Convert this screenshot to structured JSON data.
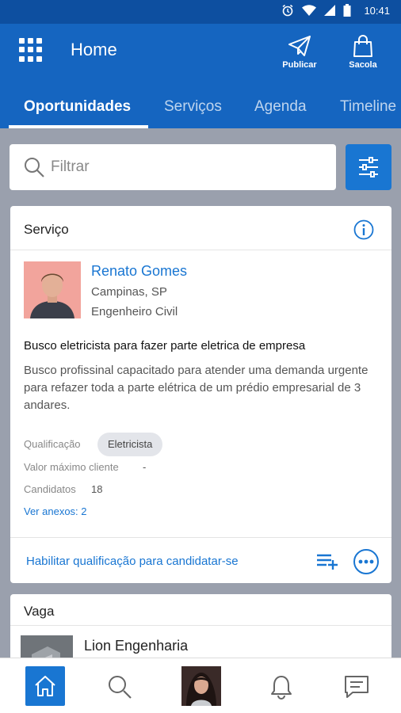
{
  "status_bar": {
    "time": "10:41"
  },
  "app_bar": {
    "title": "Home",
    "actions": [
      {
        "label": "Publicar",
        "icon": "send-icon"
      },
      {
        "label": "Sacola",
        "icon": "bag-icon"
      }
    ]
  },
  "tabs": [
    "Oportunidades",
    "Serviços",
    "Agenda",
    "Timeline"
  ],
  "search": {
    "placeholder": "Filtrar"
  },
  "service_card": {
    "header": "Serviço",
    "author": {
      "name": "Renato Gomes",
      "location": "Campinas, SP",
      "profession": "Engenheiro Civil"
    },
    "title": "Busco eletricista para fazer parte eletrica de empresa",
    "description": "Busco profissinal capacitado para atender uma demanda urgente para refazer toda a parte elétrica de um prédio empresarial de 3 andares.",
    "qualification_label": "Qualificação",
    "qualification_value": "Eletricista",
    "max_value_label": "Valor máximo cliente",
    "max_value": "-",
    "candidates_label": "Candidatos",
    "candidates_value": "18",
    "attachments_link": "Ver anexos: 2",
    "footer_action": "Habilitar qualificação para candidatar-se"
  },
  "job_card": {
    "header": "Vaga",
    "company": "Lion Engenharia"
  },
  "colors": {
    "primary": "#1565c0",
    "status_bar": "#0d4fa0",
    "accent": "#1976d2",
    "background": "#9aa0ad"
  }
}
